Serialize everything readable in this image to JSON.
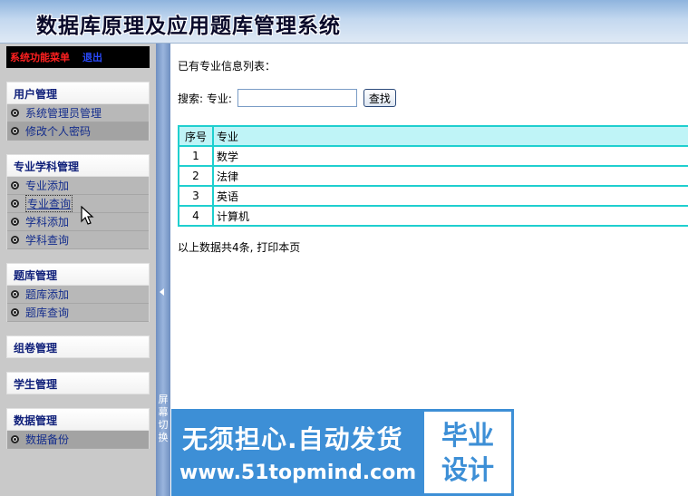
{
  "header": {
    "title": "数据库原理及应用题库管理系统"
  },
  "sidebar": {
    "top_menu": {
      "label": "系统功能菜单",
      "logout": "退出"
    },
    "groups": [
      {
        "title": "用户管理",
        "items": [
          "系统管理员管理",
          "修改个人密码"
        ]
      },
      {
        "title": "专业学科管理",
        "items": [
          "专业添加",
          "专业查询",
          "学科添加",
          "学科查询"
        ]
      },
      {
        "title": "题库管理",
        "items": [
          "题库添加",
          "题库查询"
        ]
      },
      {
        "title": "组卷管理",
        "items": []
      },
      {
        "title": "学生管理",
        "items": []
      },
      {
        "title": "数据管理",
        "items": [
          "数据备份"
        ]
      }
    ],
    "active_item": "专业查询"
  },
  "splitter": {
    "label": "屏幕切换"
  },
  "main": {
    "list_title": "已有专业信息列表：",
    "search": {
      "label": "搜索: 专业:",
      "value": "",
      "button": "查找"
    },
    "table": {
      "headers": [
        "序号",
        "专业"
      ],
      "rows": [
        [
          "1",
          "数学"
        ],
        [
          "2",
          "法律"
        ],
        [
          "3",
          "英语"
        ],
        [
          "4",
          "计算机"
        ]
      ]
    },
    "summary": "以上数据共4条, 打印本页"
  },
  "watermark": {
    "line1": "无须担心.自动发货",
    "line2": "www.51topmind.com",
    "badge_line1": "毕业",
    "badge_line2": "设计"
  }
}
